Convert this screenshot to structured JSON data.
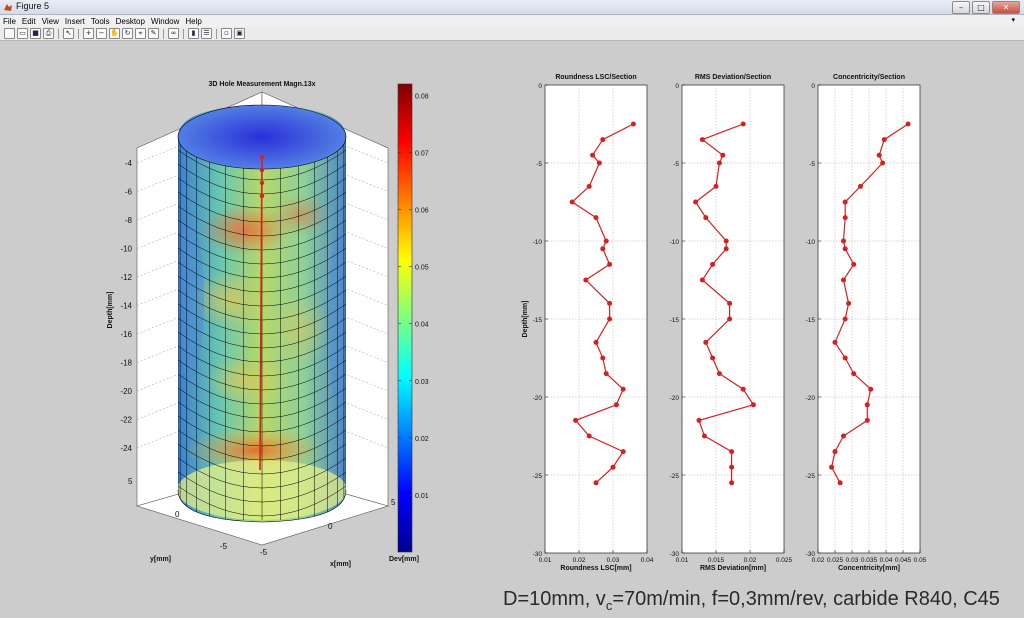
{
  "window": {
    "title": "Figure 5",
    "buttons": [
      "–",
      "□",
      "✕"
    ]
  },
  "menu": [
    "File",
    "Edit",
    "View",
    "Insert",
    "Tools",
    "Desktop",
    "Window",
    "Help"
  ],
  "toolbar_icons": [
    "new-figure-icon",
    "open-file-icon",
    "save-icon",
    "print-icon",
    "pointer-icon",
    "zoom-in-icon",
    "zoom-out-icon",
    "pan-icon",
    "rotate-3d-icon",
    "data-cursor-icon",
    "brush-icon",
    "link-icon",
    "colorbar-icon",
    "legend-icon",
    "hide-plot-tools-icon",
    "show-plot-tools-icon"
  ],
  "plot3d": {
    "title": "3D Hole Measurement  Magn.13x",
    "zlabel": "Depth[mm]",
    "ylabel": "y[mm]",
    "xlabel": "x[mm]",
    "zticks": [
      "-4",
      "-6",
      "-8",
      "-10",
      "-12",
      "-14",
      "-16",
      "-18",
      "-20",
      "-22",
      "-24"
    ],
    "yticks": [
      "5",
      "0",
      "-5"
    ],
    "xticks": [
      "-5",
      "0",
      "5"
    ]
  },
  "colorbar": {
    "label": "Dev[mm]",
    "ticks": [
      "0.08",
      "0.07",
      "0.06",
      "0.05",
      "0.04",
      "0.03",
      "0.02",
      "0.01"
    ]
  },
  "chart_data": [
    {
      "type": "line",
      "title": "Roundness LSC/Section",
      "xlabel": "Roundness LSC[mm]",
      "ylabel": "Depth[mm]",
      "xlim": [
        0.01,
        0.04
      ],
      "ylim": [
        -30,
        0
      ],
      "xticks": [
        "0.01",
        "0.02",
        "0.03",
        "0.04"
      ],
      "yticks": [
        "0",
        "-5",
        "-10",
        "-15",
        "-20",
        "-25",
        "-30"
      ],
      "grid": true,
      "color": "#d62020",
      "x": [
        0.036,
        0.027,
        0.024,
        0.026,
        0.023,
        0.018,
        0.025,
        0.028,
        0.027,
        0.029,
        0.022,
        0.029,
        0.029,
        0.025,
        0.027,
        0.028,
        0.033,
        0.031,
        0.019,
        0.023,
        0.033,
        0.03,
        0.025
      ],
      "y": [
        -2.5,
        -3.5,
        -4.5,
        -5.0,
        -6.5,
        -7.5,
        -8.5,
        -10.0,
        -10.5,
        -11.5,
        -12.5,
        -14.0,
        -15.0,
        -16.5,
        -17.5,
        -18.5,
        -19.5,
        -20.5,
        -21.5,
        -22.5,
        -23.5,
        -24.5,
        -25.5
      ]
    },
    {
      "type": "line",
      "title": "RMS Deviation/Section",
      "xlabel": "RMS Deviation[mm]",
      "ylabel": "",
      "xlim": [
        0.01,
        0.025
      ],
      "ylim": [
        -30,
        0
      ],
      "xticks": [
        "0.01",
        "0.015",
        "0.02",
        "0.025"
      ],
      "yticks": [
        "0",
        "-5",
        "-10",
        "-15",
        "-20",
        "-25",
        "-30"
      ],
      "grid": true,
      "color": "#d62020",
      "x": [
        0.019,
        0.013,
        0.016,
        0.0155,
        0.015,
        0.012,
        0.0135,
        0.0165,
        0.0165,
        0.0145,
        0.013,
        0.017,
        0.017,
        0.0135,
        0.0145,
        0.0155,
        0.019,
        0.0205,
        0.0125,
        0.0133,
        0.0173,
        0.0173,
        0.0173
      ],
      "y": [
        -2.5,
        -3.5,
        -4.5,
        -5.0,
        -6.5,
        -7.5,
        -8.5,
        -10.0,
        -10.5,
        -11.5,
        -12.5,
        -14.0,
        -15.0,
        -16.5,
        -17.5,
        -18.5,
        -19.5,
        -20.5,
        -21.5,
        -22.5,
        -23.5,
        -24.5,
        -25.5
      ]
    },
    {
      "type": "line",
      "title": "Concentricity/Section",
      "xlabel": "Concentricity[mm]",
      "ylabel": "",
      "xlim": [
        0.02,
        0.05
      ],
      "ylim": [
        -30,
        0
      ],
      "xticks": [
        "0.02",
        "0.025",
        "0.03",
        "0.035",
        "0.04",
        "0.045",
        "0.05"
      ],
      "yticks": [
        "0",
        "-5",
        "-10",
        "-15",
        "-20",
        "-25",
        "-30"
      ],
      "grid": true,
      "color": "#d62020",
      "x": [
        0.0465,
        0.0395,
        0.038,
        0.039,
        0.0325,
        0.028,
        0.028,
        0.0275,
        0.028,
        0.0305,
        0.0275,
        0.029,
        0.028,
        0.025,
        0.028,
        0.0305,
        0.0355,
        0.0345,
        0.0345,
        0.0275,
        0.025,
        0.024,
        0.0265
      ],
      "y": [
        -2.5,
        -3.5,
        -4.5,
        -5.0,
        -6.5,
        -7.5,
        -8.5,
        -10.0,
        -10.5,
        -11.5,
        -12.5,
        -14.0,
        -15.0,
        -16.5,
        -17.5,
        -18.5,
        -19.5,
        -20.5,
        -21.5,
        -22.5,
        -23.5,
        -24.5,
        -25.5
      ]
    }
  ],
  "caption": {
    "prefix": "D=10mm, v",
    "subscript": "c",
    "suffix": "=70m/min, f=0,3mm/rev, carbide R840, C45"
  }
}
